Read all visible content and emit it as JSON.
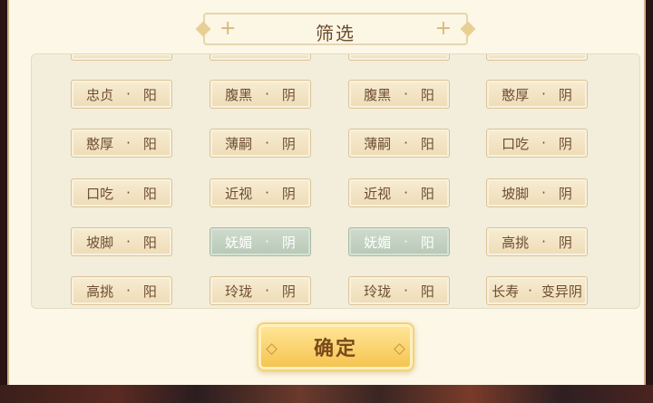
{
  "dialog": {
    "title": "筛选",
    "confirm_label": "确定"
  },
  "filters": {
    "rows": [
      [
        {
          "name": "忠贞",
          "sep": "·",
          "polarity": "阳",
          "selected": false
        },
        {
          "name": "腹黑",
          "sep": "·",
          "polarity": "阴",
          "selected": false
        },
        {
          "name": "腹黑",
          "sep": "·",
          "polarity": "阳",
          "selected": false
        },
        {
          "name": "憨厚",
          "sep": "·",
          "polarity": "阴",
          "selected": false
        }
      ],
      [
        {
          "name": "憨厚",
          "sep": "·",
          "polarity": "阳",
          "selected": false
        },
        {
          "name": "薄嗣",
          "sep": "·",
          "polarity": "阴",
          "selected": false
        },
        {
          "name": "薄嗣",
          "sep": "·",
          "polarity": "阳",
          "selected": false
        },
        {
          "name": "口吃",
          "sep": "·",
          "polarity": "阴",
          "selected": false
        }
      ],
      [
        {
          "name": "口吃",
          "sep": "·",
          "polarity": "阳",
          "selected": false
        },
        {
          "name": "近视",
          "sep": "·",
          "polarity": "阴",
          "selected": false
        },
        {
          "name": "近视",
          "sep": "·",
          "polarity": "阳",
          "selected": false
        },
        {
          "name": "坡脚",
          "sep": "·",
          "polarity": "阴",
          "selected": false
        }
      ],
      [
        {
          "name": "坡脚",
          "sep": "·",
          "polarity": "阳",
          "selected": false
        },
        {
          "name": "妩媚",
          "sep": "·",
          "polarity": "阴",
          "selected": true
        },
        {
          "name": "妩媚",
          "sep": "·",
          "polarity": "阳",
          "selected": true
        },
        {
          "name": "高挑",
          "sep": "·",
          "polarity": "阴",
          "selected": false
        }
      ],
      [
        {
          "name": "高挑",
          "sep": "·",
          "polarity": "阳",
          "selected": false
        },
        {
          "name": "玲珑",
          "sep": "·",
          "polarity": "阴",
          "selected": false
        },
        {
          "name": "玲珑",
          "sep": "·",
          "polarity": "阳",
          "selected": false
        },
        {
          "name": "长寿",
          "sep": "·",
          "polarity": "变异阴",
          "selected": false
        }
      ]
    ]
  },
  "colors": {
    "chip_normal": "#f3e4c4",
    "chip_selected": "#c2d1c0",
    "confirm_button": "#f8cf62",
    "title_text": "#6a4a2c"
  }
}
